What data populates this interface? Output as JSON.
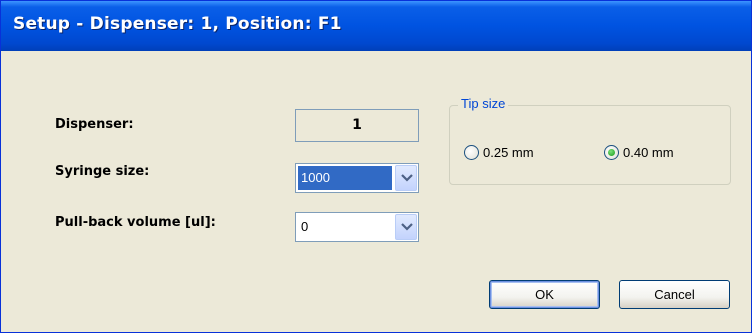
{
  "window": {
    "title": "Setup - Dispenser: 1, Position: F1"
  },
  "form": {
    "dispenser_label": "Dispenser:",
    "dispenser_value": "1",
    "syringe_label": "Syringe size:",
    "syringe_value": "1000",
    "pullback_label": "Pull-back volume [ul]:",
    "pullback_value": "0"
  },
  "tip_size": {
    "legend": "Tip size",
    "options": [
      {
        "label": "0.25 mm",
        "selected": false
      },
      {
        "label": "0.40 mm",
        "selected": true
      }
    ]
  },
  "buttons": {
    "ok": "OK",
    "cancel": "Cancel"
  },
  "colors": {
    "titlebar": "#0053e1",
    "selection": "#316ac5",
    "legend": "#0046d5"
  },
  "icons": {
    "dropdown": "chevron-down-icon",
    "radio": "radio-icon"
  }
}
